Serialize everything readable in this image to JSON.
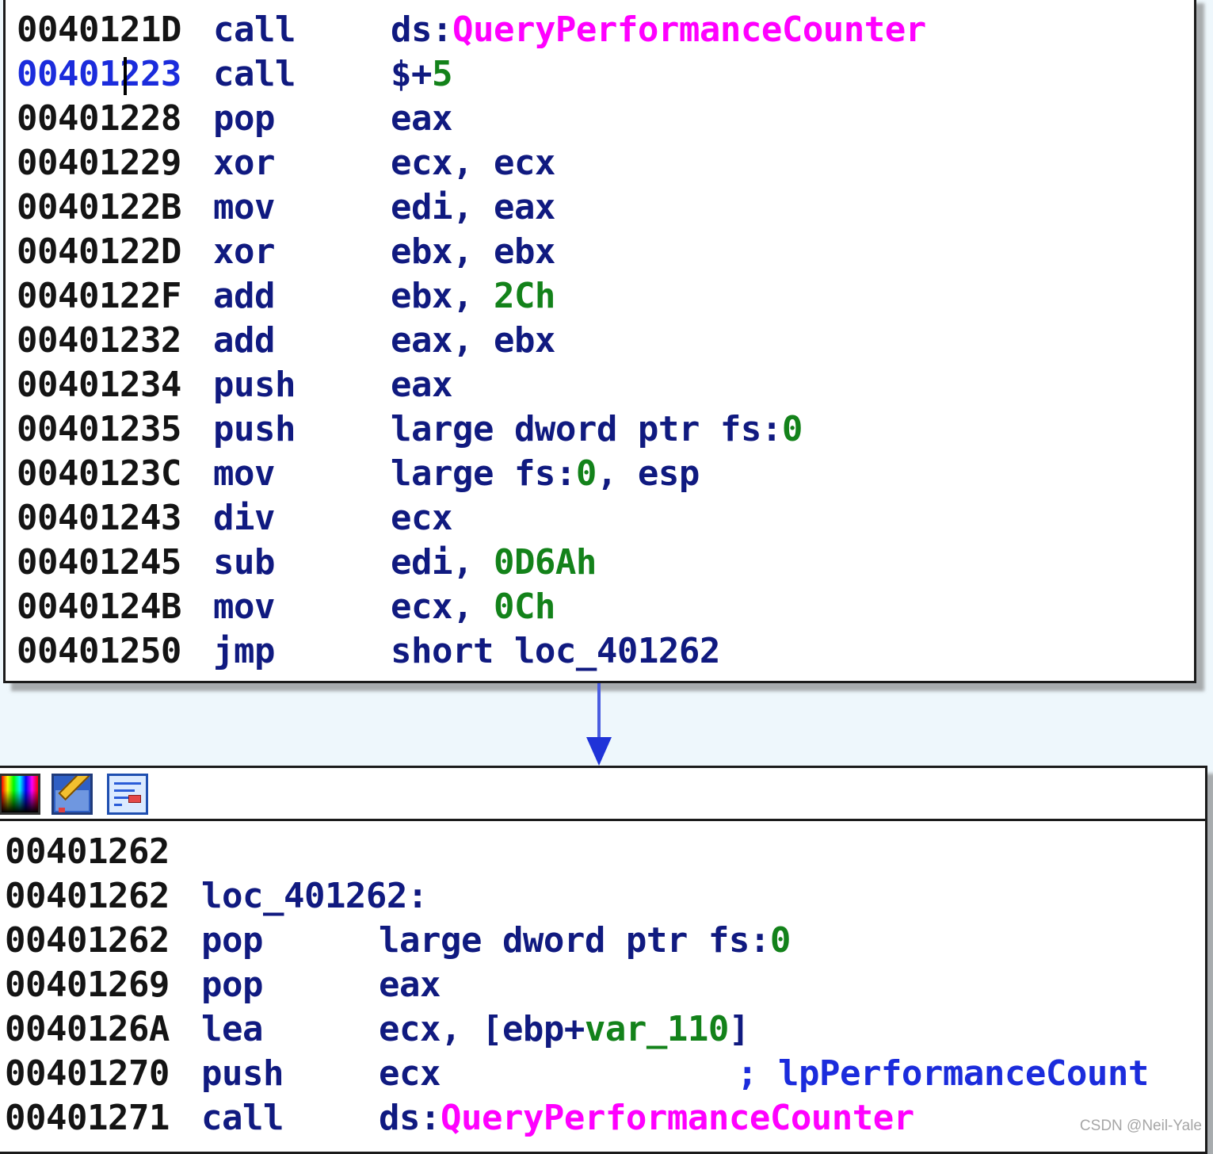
{
  "top_block": {
    "rows": [
      {
        "addr": "0040121D",
        "mnem": "call",
        "ops": [
          {
            "t": "ds:",
            "c": "reg"
          },
          {
            "t": "QueryPerformanceCounter",
            "c": "imp"
          }
        ]
      },
      {
        "addr": "00401223",
        "mnem": "call",
        "ops": [
          {
            "t": "$+",
            "c": "reg"
          },
          {
            "t": "5",
            "c": "num"
          }
        ]
      },
      {
        "addr": "00401228",
        "mnem": "pop",
        "ops": [
          {
            "t": "eax",
            "c": "reg"
          }
        ]
      },
      {
        "addr": "00401229",
        "mnem": "xor",
        "ops": [
          {
            "t": "ecx, ecx",
            "c": "reg"
          }
        ]
      },
      {
        "addr": "0040122B",
        "mnem": "mov",
        "ops": [
          {
            "t": "edi, eax",
            "c": "reg"
          }
        ]
      },
      {
        "addr": "0040122D",
        "mnem": "xor",
        "ops": [
          {
            "t": "ebx, ebx",
            "c": "reg"
          }
        ]
      },
      {
        "addr": "0040122F",
        "mnem": "add",
        "ops": [
          {
            "t": "ebx, ",
            "c": "reg"
          },
          {
            "t": "2Ch",
            "c": "num"
          }
        ]
      },
      {
        "addr": "00401232",
        "mnem": "add",
        "ops": [
          {
            "t": "eax, ebx",
            "c": "reg"
          }
        ]
      },
      {
        "addr": "00401234",
        "mnem": "push",
        "ops": [
          {
            "t": "eax",
            "c": "reg"
          }
        ]
      },
      {
        "addr": "00401235",
        "mnem": "push",
        "ops": [
          {
            "t": "large dword ptr fs:",
            "c": "reg"
          },
          {
            "t": "0",
            "c": "num"
          }
        ]
      },
      {
        "addr": "0040123C",
        "mnem": "mov",
        "ops": [
          {
            "t": "large fs:",
            "c": "reg"
          },
          {
            "t": "0",
            "c": "num"
          },
          {
            "t": ", esp",
            "c": "reg"
          }
        ]
      },
      {
        "addr": "00401243",
        "mnem": "div",
        "ops": [
          {
            "t": "ecx",
            "c": "reg"
          }
        ]
      },
      {
        "addr": "00401245",
        "mnem": "sub",
        "ops": [
          {
            "t": "edi, ",
            "c": "reg"
          },
          {
            "t": "0D6Ah",
            "c": "num"
          }
        ]
      },
      {
        "addr": "0040124B",
        "mnem": "mov",
        "ops": [
          {
            "t": "ecx, ",
            "c": "reg"
          },
          {
            "t": "0Ch",
            "c": "num"
          }
        ]
      },
      {
        "addr": "00401250",
        "mnem": "jmp",
        "ops": [
          {
            "t": "short loc_401262",
            "c": "reg"
          }
        ]
      }
    ]
  },
  "bottom_block": {
    "toolbar": {
      "icons": [
        "color-palette-icon",
        "edit-node-icon",
        "graph-overview-icon"
      ]
    },
    "rows": [
      {
        "addr": "00401262",
        "mnem": "",
        "ops": []
      },
      {
        "addr": "00401262",
        "label": "loc_401262:"
      },
      {
        "addr": "00401262",
        "mnem": "pop",
        "ops": [
          {
            "t": "large dword ptr fs:",
            "c": "reg"
          },
          {
            "t": "0",
            "c": "num"
          }
        ]
      },
      {
        "addr": "00401269",
        "mnem": "pop",
        "ops": [
          {
            "t": "eax",
            "c": "reg"
          }
        ]
      },
      {
        "addr": "0040126A",
        "mnem": "lea",
        "ops": [
          {
            "t": "ecx, [ebp+",
            "c": "reg"
          },
          {
            "t": "var_110",
            "c": "var"
          },
          {
            "t": "]",
            "c": "reg"
          }
        ]
      },
      {
        "addr": "00401270",
        "mnem": "push",
        "ops": [
          {
            "t": "ecx",
            "c": "reg"
          }
        ],
        "comment": "; lpPerformanceCount"
      },
      {
        "addr": "00401271",
        "mnem": "call",
        "ops": [
          {
            "t": "ds:",
            "c": "reg"
          },
          {
            "t": "QueryPerformanceCounter",
            "c": "imp"
          }
        ]
      }
    ]
  },
  "watermark": "CSDN @Neil-Yale",
  "colors": {
    "address": "#141414",
    "selected_address": "#1b2cdc",
    "mnemonic": "#101a80",
    "number": "#13821a",
    "import": "#ff00ff",
    "comment": "#1b2cdc",
    "edge": "#1f33d8",
    "background": "#eef7fc"
  }
}
